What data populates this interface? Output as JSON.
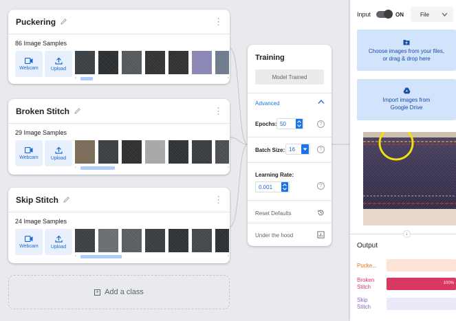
{
  "classes": [
    {
      "name": "Puckering",
      "samples_text": "86 Image Samples",
      "webcam_label": "Webcam",
      "upload_label": "Upload",
      "thumb_colors": [
        "#3a3f44",
        "#2b2e30",
        "#55585a",
        "#303234",
        "#2e3032",
        "#8a86b3",
        "#6e7a8c",
        "#40464a"
      ]
    },
    {
      "name": "Broken Stitch",
      "samples_text": "29 Image Samples",
      "webcam_label": "Webcam",
      "upload_label": "Upload",
      "thumb_colors": [
        "#7a6a58",
        "#3b3e41",
        "#2c2e30",
        "#a5a7a9",
        "#2f3235",
        "#393c3f",
        "#4a4d50",
        "#8c8e90"
      ]
    },
    {
      "name": "Skip Stitch",
      "samples_text": "24 Image Samples",
      "webcam_label": "Webcam",
      "upload_label": "Upload",
      "thumb_colors": [
        "#3c3f42",
        "#6a6d70",
        "#5a5d60",
        "#3a3d40",
        "#2f3234",
        "#444749",
        "#2d3032",
        "#38393b"
      ]
    }
  ],
  "add_class_label": "Add a class",
  "training": {
    "title": "Training",
    "model_button": "Model Trained",
    "advanced_label": "Advanced",
    "epochs_label": "Epochs:",
    "epochs_value": "50",
    "batch_label": "Batch Size:",
    "batch_value": "16",
    "lr_label": "Learning Rate:",
    "lr_value": "0.001",
    "reset_label": "Reset Defaults",
    "hood_label": "Under the hood"
  },
  "preview": {
    "input_label": "Input",
    "toggle_state": "ON",
    "source_select": "File",
    "drop_text_1": "Choose images from your files,",
    "drop_text_2": "or drag & drop here",
    "drive_text_1": "Import images from",
    "drive_text_2": "Google Drive",
    "output_title": "Output"
  },
  "output": [
    {
      "label": "Pucke...",
      "color": "#e8710a",
      "bg": "#fde4d6",
      "confidence": 0,
      "value_text": ""
    },
    {
      "label_1": "Broken",
      "label_2": "Stitch",
      "color": "#d93961",
      "bg": "#f7c9d4",
      "confidence": 100,
      "value_text": "100%"
    },
    {
      "label_1": "Skip",
      "label_2": "Stitch",
      "color": "#8a63d2",
      "bg": "#ede7fa",
      "confidence": 0,
      "value_text": ""
    }
  ],
  "colors": {
    "accent": "#1a73e8",
    "light_accent": "#e8f0fe",
    "panel_bg": "#e8eaed"
  }
}
